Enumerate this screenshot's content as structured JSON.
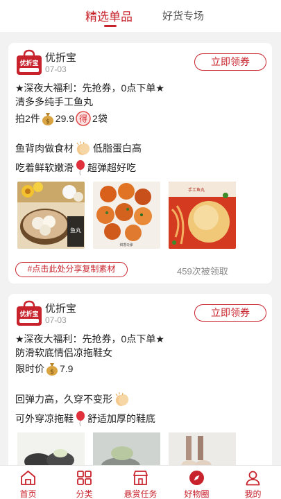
{
  "tabs": {
    "active": "精选单品",
    "inactive": "好货专场"
  },
  "card1": {
    "shop_name": "优折宝",
    "date": "07-03",
    "coupon_button": "立即领券",
    "line1": "★深夜大福利：先抢券，0点下单★",
    "line2": "清多多纯手工鱼丸",
    "price_prefix": "拍2件",
    "price": "29.9",
    "price_suffix": "2袋",
    "line4a": "鱼背肉做食材",
    "line4b": "低脂蛋白高",
    "line5a": "吃着鲜软嫩滑",
    "line5b": "超弹超好吃",
    "share_button": "#点击此处分享复制素材",
    "claim_count": "459次被领取"
  },
  "card2": {
    "shop_name": "优折宝",
    "date": "07-03",
    "coupon_button": "立即领券",
    "line1": "★深夜大福利：先抢券，0点下单★",
    "line2": "防滑软底情侣凉拖鞋女",
    "price_prefix": "限时价",
    "price": "7.9",
    "line4a": "回弹力高，久穿不变形",
    "line5a": "可外穿凉拖鞋",
    "line5b": "舒适加厚的鞋底"
  },
  "logo_text": "优折宝",
  "de_glyph": "得",
  "photo_labels": {
    "fishball_tag": "鱼丸",
    "caption2": "鲜香Q弹",
    "caption3": "手工鱼丸"
  },
  "nav": [
    {
      "label": "首页",
      "icon": "home-icon"
    },
    {
      "label": "分类",
      "icon": "grid-icon"
    },
    {
      "label": "悬赏任务",
      "icon": "store-icon"
    },
    {
      "label": "好物圈",
      "icon": "compass-icon"
    },
    {
      "label": "我的",
      "icon": "user-icon"
    }
  ],
  "colors": {
    "accent": "#c8232c",
    "background": "#f2f2f2"
  }
}
